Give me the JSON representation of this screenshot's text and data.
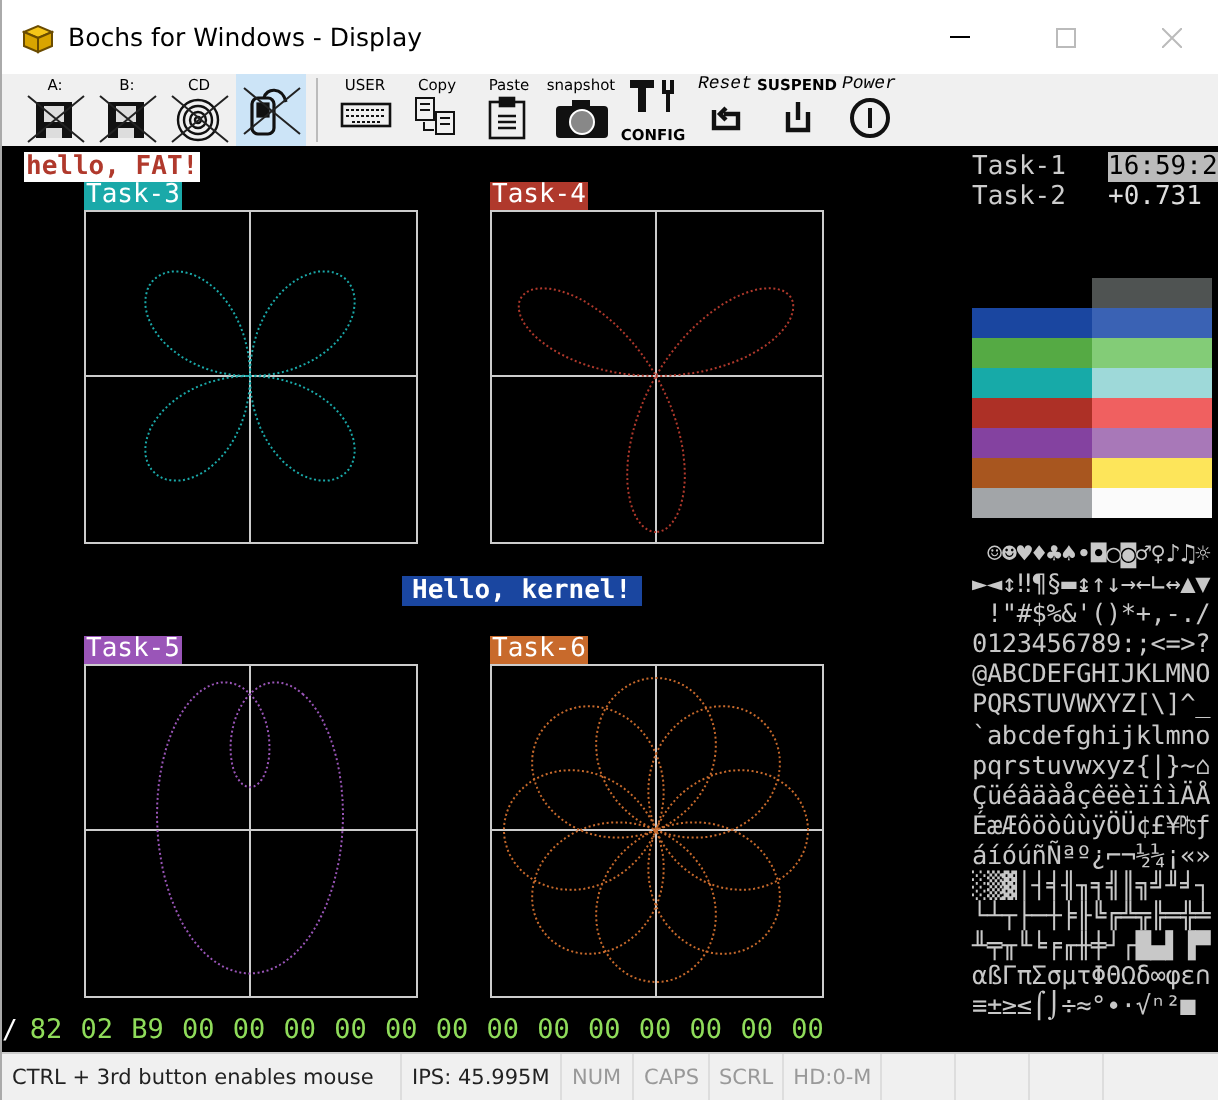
{
  "window": {
    "title": "Bochs for Windows - Display"
  },
  "toolbar": [
    {
      "kind": "floppy",
      "label": "A:",
      "crossed": true,
      "selected": false
    },
    {
      "kind": "floppy",
      "label": "B:",
      "crossed": true,
      "selected": false
    },
    {
      "kind": "cdrom",
      "label": "CD",
      "crossed": true,
      "selected": false
    },
    {
      "kind": "mouse",
      "crossed": true,
      "selected": true
    },
    {
      "kind": "keyboard",
      "label": "USER",
      "crossed": false,
      "selected": false
    },
    {
      "kind": "copy",
      "label": "Copy",
      "crossed": false,
      "selected": false
    },
    {
      "kind": "paste",
      "label": "Paste",
      "crossed": false,
      "selected": false
    },
    {
      "kind": "camera",
      "label": "snapshot",
      "crossed": false,
      "selected": false
    },
    {
      "kind": "config",
      "label": "CONFIG",
      "crossed": false,
      "selected": false
    },
    {
      "kind": "reset",
      "label": "Reset",
      "crossed": false,
      "selected": false
    },
    {
      "kind": "suspend",
      "label": "SUSPEND",
      "crossed": false,
      "selected": false
    },
    {
      "kind": "power",
      "label": "Power",
      "crossed": false,
      "selected": false
    }
  ],
  "screen": {
    "banner": "hello, FAT!",
    "plots": [
      {
        "label": "Task-3",
        "color": "#1aa9a9",
        "kind": "rose4"
      },
      {
        "label": "Task-4",
        "color": "#b0392c",
        "kind": "rose3"
      },
      {
        "label": "Task-5",
        "color": "#9a55b8",
        "kind": "limacon"
      },
      {
        "label": "Task-6",
        "color": "#c86a2c",
        "kind": "circles"
      }
    ],
    "message": "Hello, kernel!",
    "tasks": [
      {
        "name": "Task-1",
        "value": "16:59:2",
        "highlighted": true
      },
      {
        "name": "Task-2",
        "value": "+0.731",
        "highlighted": false
      }
    ],
    "palette_left": [
      {
        "color": "#1a46a0"
      },
      {
        "color": "#55aa44"
      },
      {
        "color": "#17aaa8"
      },
      {
        "color": "#ad3026"
      },
      {
        "color": "#8442a0"
      },
      {
        "color": "#a8561f"
      },
      {
        "color": "#a2a5a8"
      }
    ],
    "palette_right": [
      {
        "color": "#4f5352"
      },
      {
        "color": "#3a62b4"
      },
      {
        "color": "#83cc77"
      },
      {
        "color": "#9ed9d9"
      },
      {
        "color": "#f06060"
      },
      {
        "color": "#a878b8"
      },
      {
        "color": "#fde55a"
      },
      {
        "color": "#fbfbfb"
      }
    ],
    "charset": [
      " ☺☻♥♦♣♠•◘○◙♂♀♪♫☼",
      "►◄↕‼¶§▬↨↑↓→←∟↔▲▼",
      " !\"#$%&'()*+,-./",
      "0123456789:;<=>?",
      "@ABCDEFGHIJKLMNO",
      "PQRSTUVWXYZ[\\]^_",
      "`abcdefghijklmno",
      "pqrstuvwxyz{|}~⌂",
      "ÇüéâäàåçêëèïîìÄÅ",
      "ÉæÆôöòûùÿÖÜ¢£¥₧ƒ",
      "áíóúñÑªº¿⌐¬½¼¡«»",
      "░▒▓│┤╡╢╖╕╣║╗╝╜╛┐",
      "└┴┬├─┼╞╟╚╔╩╦╠═╬╧",
      "╨╤╥╙╘╒╓╫╪┘┌█▄▌▐▀",
      "αßΓπΣσµτΦΘΩδ∞φε∩",
      "≡±≥≤⌠⌡÷≈°∙·√ⁿ²■"
    ],
    "cursor": "/",
    "hex_line": "82 02 B9 00 00 00 00 00 00 00 00 00 00 00 00 00"
  },
  "status_bar": [
    {
      "text": "CTRL + 3rd button enables mouse",
      "disabled": false
    },
    {
      "text": "IPS: 45.995M",
      "disabled": false
    },
    {
      "text": "NUM",
      "disabled": true
    },
    {
      "text": "CAPS",
      "disabled": true
    },
    {
      "text": "SCRL",
      "disabled": true
    },
    {
      "text": "HD:0-M",
      "disabled": true
    }
  ]
}
